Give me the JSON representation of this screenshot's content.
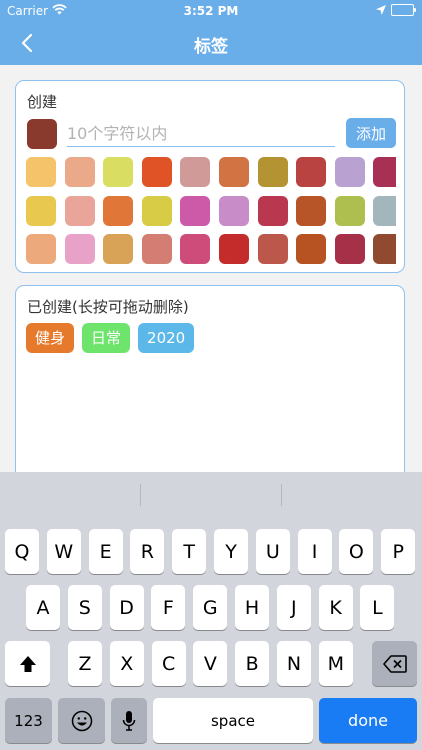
{
  "status_bar": {
    "carrier": "Carrier",
    "time": "3:52 PM"
  },
  "nav": {
    "title": "标签"
  },
  "create": {
    "title": "创建",
    "selected_color": "#8a3a2c",
    "input_placeholder": "10个字符以内",
    "input_value": "",
    "add_label": "添加",
    "colors": [
      [
        "#f4c36a",
        "#eaa989",
        "#d9dd62",
        "#e05326",
        "#cf9a97",
        "#d27344",
        "#b39332",
        "#b94340",
        "#b9a2d2",
        "#a83055"
      ],
      [
        "#e9c84f",
        "#e9a59a",
        "#e07637",
        "#d8cc46",
        "#cc5aa8",
        "#c88dc9",
        "#b9374f",
        "#b75529",
        "#aebf4f",
        "#a3b6bb"
      ],
      [
        "#eca97b",
        "#e8a1c7",
        "#d8a357",
        "#d47e73",
        "#ce4c79",
        "#c42c2c",
        "#bc584b",
        "#b75223",
        "#a73049",
        "#8f4a2f"
      ]
    ]
  },
  "created": {
    "title": "已创建(长按可拖动删除)",
    "tags": [
      {
        "label": "健身",
        "color": "#e67a2c"
      },
      {
        "label": "日常",
        "color": "#6fe46d"
      },
      {
        "label": "2020",
        "color": "#5cb8e8"
      }
    ]
  },
  "keyboard": {
    "row1": [
      "Q",
      "W",
      "E",
      "R",
      "T",
      "Y",
      "U",
      "I",
      "O",
      "P"
    ],
    "row2": [
      "A",
      "S",
      "D",
      "F",
      "G",
      "H",
      "J",
      "K",
      "L"
    ],
    "row3": [
      "Z",
      "X",
      "C",
      "V",
      "B",
      "N",
      "M"
    ],
    "numbers_label": "123",
    "space_label": "space",
    "done_label": "done"
  }
}
